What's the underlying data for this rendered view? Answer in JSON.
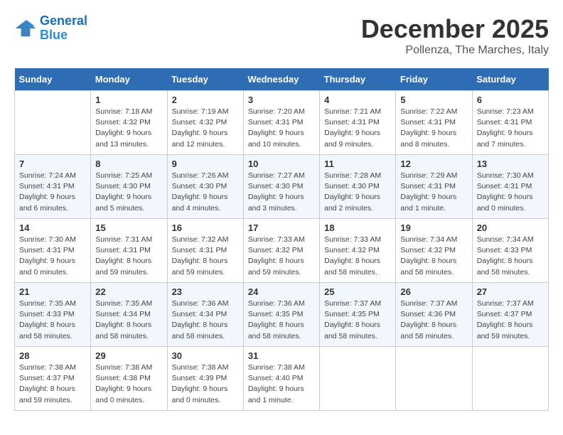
{
  "logo": {
    "line1": "General",
    "line2": "Blue"
  },
  "title": "December 2025",
  "location": "Pollenza, The Marches, Italy",
  "days_of_week": [
    "Sunday",
    "Monday",
    "Tuesday",
    "Wednesday",
    "Thursday",
    "Friday",
    "Saturday"
  ],
  "weeks": [
    [
      {
        "day": "",
        "info": ""
      },
      {
        "day": "1",
        "info": "Sunrise: 7:18 AM\nSunset: 4:32 PM\nDaylight: 9 hours\nand 13 minutes."
      },
      {
        "day": "2",
        "info": "Sunrise: 7:19 AM\nSunset: 4:32 PM\nDaylight: 9 hours\nand 12 minutes."
      },
      {
        "day": "3",
        "info": "Sunrise: 7:20 AM\nSunset: 4:31 PM\nDaylight: 9 hours\nand 10 minutes."
      },
      {
        "day": "4",
        "info": "Sunrise: 7:21 AM\nSunset: 4:31 PM\nDaylight: 9 hours\nand 9 minutes."
      },
      {
        "day": "5",
        "info": "Sunrise: 7:22 AM\nSunset: 4:31 PM\nDaylight: 9 hours\nand 8 minutes."
      },
      {
        "day": "6",
        "info": "Sunrise: 7:23 AM\nSunset: 4:31 PM\nDaylight: 9 hours\nand 7 minutes."
      }
    ],
    [
      {
        "day": "7",
        "info": "Sunrise: 7:24 AM\nSunset: 4:31 PM\nDaylight: 9 hours\nand 6 minutes."
      },
      {
        "day": "8",
        "info": "Sunrise: 7:25 AM\nSunset: 4:30 PM\nDaylight: 9 hours\nand 5 minutes."
      },
      {
        "day": "9",
        "info": "Sunrise: 7:26 AM\nSunset: 4:30 PM\nDaylight: 9 hours\nand 4 minutes."
      },
      {
        "day": "10",
        "info": "Sunrise: 7:27 AM\nSunset: 4:30 PM\nDaylight: 9 hours\nand 3 minutes."
      },
      {
        "day": "11",
        "info": "Sunrise: 7:28 AM\nSunset: 4:30 PM\nDaylight: 9 hours\nand 2 minutes."
      },
      {
        "day": "12",
        "info": "Sunrise: 7:29 AM\nSunset: 4:31 PM\nDaylight: 9 hours\nand 1 minute."
      },
      {
        "day": "13",
        "info": "Sunrise: 7:30 AM\nSunset: 4:31 PM\nDaylight: 9 hours\nand 0 minutes."
      }
    ],
    [
      {
        "day": "14",
        "info": "Sunrise: 7:30 AM\nSunset: 4:31 PM\nDaylight: 9 hours\nand 0 minutes."
      },
      {
        "day": "15",
        "info": "Sunrise: 7:31 AM\nSunset: 4:31 PM\nDaylight: 8 hours\nand 59 minutes."
      },
      {
        "day": "16",
        "info": "Sunrise: 7:32 AM\nSunset: 4:31 PM\nDaylight: 8 hours\nand 59 minutes."
      },
      {
        "day": "17",
        "info": "Sunrise: 7:33 AM\nSunset: 4:32 PM\nDaylight: 8 hours\nand 59 minutes."
      },
      {
        "day": "18",
        "info": "Sunrise: 7:33 AM\nSunset: 4:32 PM\nDaylight: 8 hours\nand 58 minutes."
      },
      {
        "day": "19",
        "info": "Sunrise: 7:34 AM\nSunset: 4:32 PM\nDaylight: 8 hours\nand 58 minutes."
      },
      {
        "day": "20",
        "info": "Sunrise: 7:34 AM\nSunset: 4:33 PM\nDaylight: 8 hours\nand 58 minutes."
      }
    ],
    [
      {
        "day": "21",
        "info": "Sunrise: 7:35 AM\nSunset: 4:33 PM\nDaylight: 8 hours\nand 58 minutes."
      },
      {
        "day": "22",
        "info": "Sunrise: 7:35 AM\nSunset: 4:34 PM\nDaylight: 8 hours\nand 58 minutes."
      },
      {
        "day": "23",
        "info": "Sunrise: 7:36 AM\nSunset: 4:34 PM\nDaylight: 8 hours\nand 58 minutes."
      },
      {
        "day": "24",
        "info": "Sunrise: 7:36 AM\nSunset: 4:35 PM\nDaylight: 8 hours\nand 58 minutes."
      },
      {
        "day": "25",
        "info": "Sunrise: 7:37 AM\nSunset: 4:35 PM\nDaylight: 8 hours\nand 58 minutes."
      },
      {
        "day": "26",
        "info": "Sunrise: 7:37 AM\nSunset: 4:36 PM\nDaylight: 8 hours\nand 58 minutes."
      },
      {
        "day": "27",
        "info": "Sunrise: 7:37 AM\nSunset: 4:37 PM\nDaylight: 8 hours\nand 59 minutes."
      }
    ],
    [
      {
        "day": "28",
        "info": "Sunrise: 7:38 AM\nSunset: 4:37 PM\nDaylight: 8 hours\nand 59 minutes."
      },
      {
        "day": "29",
        "info": "Sunrise: 7:38 AM\nSunset: 4:38 PM\nDaylight: 9 hours\nand 0 minutes."
      },
      {
        "day": "30",
        "info": "Sunrise: 7:38 AM\nSunset: 4:39 PM\nDaylight: 9 hours\nand 0 minutes."
      },
      {
        "day": "31",
        "info": "Sunrise: 7:38 AM\nSunset: 4:40 PM\nDaylight: 9 hours\nand 1 minute."
      },
      {
        "day": "",
        "info": ""
      },
      {
        "day": "",
        "info": ""
      },
      {
        "day": "",
        "info": ""
      }
    ]
  ]
}
